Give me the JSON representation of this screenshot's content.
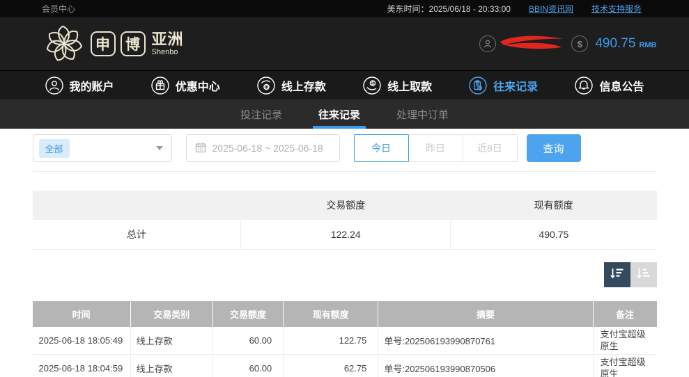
{
  "topbar": {
    "member_center": "会员中心",
    "time_label": "美东时间：2025/06/18 - 20:33:00",
    "links": [
      {
        "label": "BBIN资讯网"
      },
      {
        "label": "技术支持服务"
      }
    ]
  },
  "header": {
    "logo": {
      "char1": "申",
      "char2": "博",
      "region": "亚洲",
      "sub": "Shenbo"
    },
    "balance": {
      "symbol": "$",
      "amount": "490.75",
      "currency": "RMB"
    }
  },
  "nav": {
    "items": [
      {
        "label": "我的账户",
        "icon": "user-icon",
        "active": false
      },
      {
        "label": "优惠中心",
        "icon": "gift-icon",
        "active": false
      },
      {
        "label": "线上存款",
        "icon": "deposit-icon",
        "active": false
      },
      {
        "label": "线上取款",
        "icon": "withdraw-icon",
        "active": false
      },
      {
        "label": "往来记录",
        "icon": "records-icon",
        "active": true
      },
      {
        "label": "信息公告",
        "icon": "bell-icon",
        "active": false
      }
    ]
  },
  "subnav": {
    "tabs": [
      {
        "label": "投注记录",
        "active": false
      },
      {
        "label": "往来记录",
        "active": true
      },
      {
        "label": "处理中订单",
        "active": false
      }
    ]
  },
  "filters": {
    "type_selected": "全部",
    "date_range": "2025-06-18 ~ 2025-06-18",
    "quick_ranges": [
      {
        "label": "今日",
        "active": true
      },
      {
        "label": "昨日",
        "active": false
      },
      {
        "label": "近8日",
        "active": false
      }
    ],
    "search_label": "查询"
  },
  "summary": {
    "headers": [
      "",
      "交易额度",
      "现有额度"
    ],
    "row": {
      "label": "总计",
      "values": [
        "122.24",
        "490.75"
      ]
    }
  },
  "records": {
    "headers": [
      "时间",
      "交易类别",
      "交易额度",
      "现有额度",
      "摘要",
      "备注"
    ],
    "rows": [
      {
        "time": "2025-06-18 18:05:49",
        "type": "线上存款",
        "amount": "60.00",
        "balance": "122.75",
        "summary": "单号:202506193990870761",
        "note": "支付宝超级原生"
      },
      {
        "time": "2025-06-18 18:04:59",
        "type": "线上存款",
        "amount": "60.00",
        "balance": "62.75",
        "summary": "单号:202506193990870506",
        "note": "支付宝超级原生"
      }
    ]
  },
  "colors": {
    "accent_blue": "#3d9be9",
    "query_button_blue": "#4da3ed",
    "sort_active_bg": "#34495e",
    "records_header_bg": "#b5b5b5",
    "logo_cream": "#ece5cf",
    "redaction_red": "#e3261d",
    "header_bg": "#1e1e1e"
  }
}
